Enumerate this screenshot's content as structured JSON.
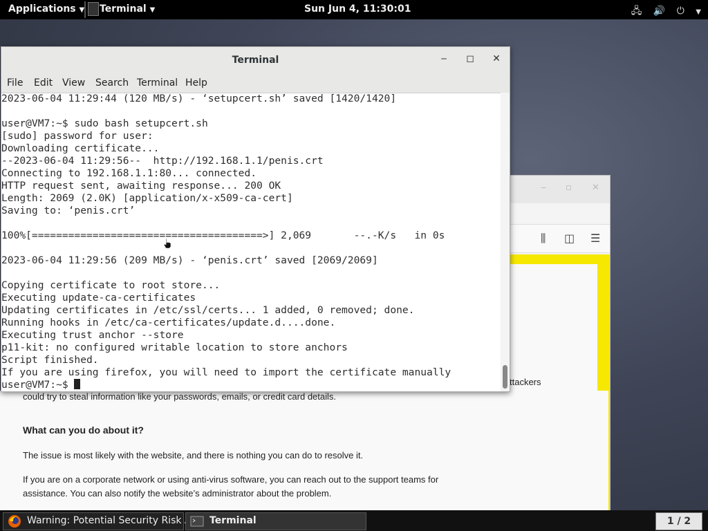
{
  "topbar": {
    "applications": "Applications",
    "terminal_menu": "Terminal",
    "clock": "Sun Jun  4, 11:30:01"
  },
  "browser": {
    "body_line_attackers": "ttackers",
    "body_line_steal": "could try to steal information like your passwords, emails, or credit card details.",
    "heading_what": "What can you do about it?",
    "para_issue": "The issue is most likely with the website, and there is nothing you can do to resolve it.",
    "para_corp_1": "If you are on a corporate network or using anti-virus software, you can reach out to the support teams for",
    "para_corp_2": "assistance. You can also notify the website’s administrator about the problem.",
    "yellow_color": "#f6e800"
  },
  "terminal": {
    "title": "Terminal",
    "menu": [
      "File",
      "Edit",
      "View",
      "Search",
      "Terminal",
      "Help"
    ],
    "lines": [
      "2023-06-04 11:29:44 (120 MB/s) - ‘setupcert.sh’ saved [1420/1420]",
      "",
      "user@VM7:~$ sudo bash setupcert.sh",
      "[sudo] password for user:",
      "Downloading certificate...",
      "--2023-06-04 11:29:56--  http://192.168.1.1/penis.crt",
      "Connecting to 192.168.1.1:80... connected.",
      "HTTP request sent, awaiting response... 200 OK",
      "Length: 2069 (2.0K) [application/x-x509-ca-cert]",
      "Saving to: ‘penis.crt’",
      "",
      "100%[======================================>] 2,069       --.-K/s   in 0s",
      "",
      "2023-06-04 11:29:56 (209 MB/s) - ‘penis.crt’ saved [2069/2069]",
      "",
      "Copying certificate to root store...",
      "Executing update-ca-certificates",
      "Updating certificates in /etc/ssl/certs... 1 added, 0 removed; done.",
      "Running hooks in /etc/ca-certificates/update.d....done.",
      "Executing trust anchor --store",
      "p11-kit: no configured writable location to store anchors",
      "Script finished.",
      "If you are using firefox, you will need to import the certificate manually"
    ],
    "prompt": "user@VM7:~$ "
  },
  "taskbar": {
    "firefox_task": "Warning: Potential Security Risk A...",
    "terminal_task": "Terminal",
    "workspace": "1 / 2"
  }
}
